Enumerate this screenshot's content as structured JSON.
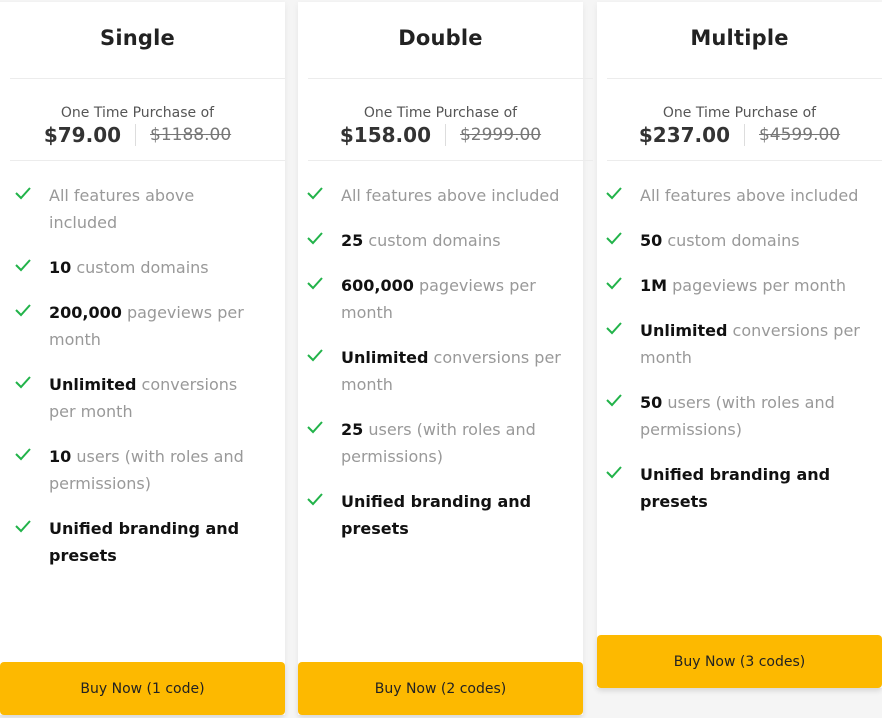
{
  "colors": {
    "accent_button": "#fdb900",
    "check_green": "#22b34a",
    "muted_text": "#999999",
    "strong_text": "#111111"
  },
  "plans": [
    {
      "title": "Single",
      "price_label": "One Time Purchase of",
      "price": "$79.00",
      "original_price": "$1188.00",
      "features": [
        {
          "strong": "",
          "rest": "All features above included",
          "icon": "check-icon"
        },
        {
          "strong": "10",
          "rest": " custom domains",
          "icon": "check-icon"
        },
        {
          "strong": "200,000",
          "rest": " pageviews per month",
          "icon": "check-icon"
        },
        {
          "strong": "Unlimited",
          "rest": " conversions per month",
          "icon": "check-icon"
        },
        {
          "strong": "10",
          "rest": " users (with roles and permissions)",
          "icon": "check-icon"
        },
        {
          "strong": "Unified branding and presets",
          "rest": "",
          "icon": "check-icon"
        }
      ],
      "button_label": "Buy Now (1 code)"
    },
    {
      "title": "Double",
      "price_label": "One Time Purchase of",
      "price": "$158.00",
      "original_price": "$2999.00",
      "features": [
        {
          "strong": "",
          "rest": "All features above included",
          "icon": "check-icon"
        },
        {
          "strong": "25",
          "rest": " custom domains",
          "icon": "check-icon"
        },
        {
          "strong": "600,000",
          "rest": " pageviews per month",
          "icon": "check-icon"
        },
        {
          "strong": "Unlimited",
          "rest": " conversions per month",
          "icon": "check-icon"
        },
        {
          "strong": "25",
          "rest": " users (with roles and permissions)",
          "icon": "check-icon"
        },
        {
          "strong": "Unified branding and presets",
          "rest": "",
          "icon": "check-icon"
        }
      ],
      "button_label": "Buy Now (2 codes)"
    },
    {
      "title": "Multiple",
      "price_label": "One Time Purchase of",
      "price": "$237.00",
      "original_price": "$4599.00",
      "features": [
        {
          "strong": "",
          "rest": "All features above included",
          "icon": "check-icon"
        },
        {
          "strong": "50",
          "rest": " custom domains",
          "icon": "check-icon"
        },
        {
          "strong": "1M",
          "rest": " pageviews per month",
          "icon": "check-icon"
        },
        {
          "strong": "Unlimited",
          "rest": " conversions per month",
          "icon": "check-icon"
        },
        {
          "strong": "50",
          "rest": " users (with roles and permissions)",
          "icon": "check-icon"
        },
        {
          "strong": "Unified branding and presets",
          "rest": "",
          "icon": "check-icon"
        }
      ],
      "button_label": "Buy Now (3 codes)"
    }
  ]
}
